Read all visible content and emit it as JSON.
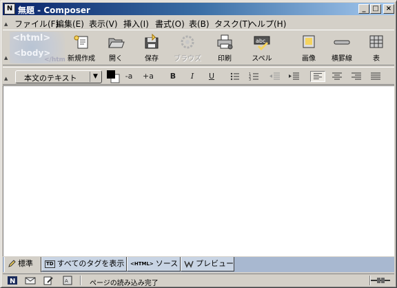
{
  "window": {
    "title": "無題 - Composer",
    "controls": {
      "minimize": "_",
      "maximize": "□",
      "close": "×"
    }
  },
  "menu": {
    "items": [
      "ファイル(F)",
      "編集(E)",
      "表示(V)",
      "挿入(I)",
      "書式(O)",
      "表(B)",
      "タスク(T)",
      "ヘルプ(H)"
    ]
  },
  "logo": {
    "line1": "<html>",
    "line2": "<body>",
    "line3": "</html>"
  },
  "toolbar": {
    "new": "新規作成",
    "open": "開く",
    "save": "保存",
    "browse": "ブラウズ",
    "print": "印刷",
    "spell": "スペル",
    "image": "画像",
    "hline": "横罫線",
    "table": "表"
  },
  "format": {
    "paragraph_style": "本文のテキスト",
    "smaller": "-a",
    "larger": "+a",
    "bold": "B",
    "italic": "I",
    "underline": "U"
  },
  "tabs": {
    "normal": "標準",
    "show_tags": "すべてのタグを表示",
    "source": "ソース",
    "source_prefix": "<HTML>",
    "preview": "プレビュー",
    "tags_badge": "TD"
  },
  "status": {
    "text": "ページの読み込み完了"
  },
  "colors": {
    "titlebar_start": "#0a246a",
    "titlebar_end": "#a6caf0",
    "chrome": "#d4d0c8",
    "tab_strip": "#a8b8d0"
  }
}
